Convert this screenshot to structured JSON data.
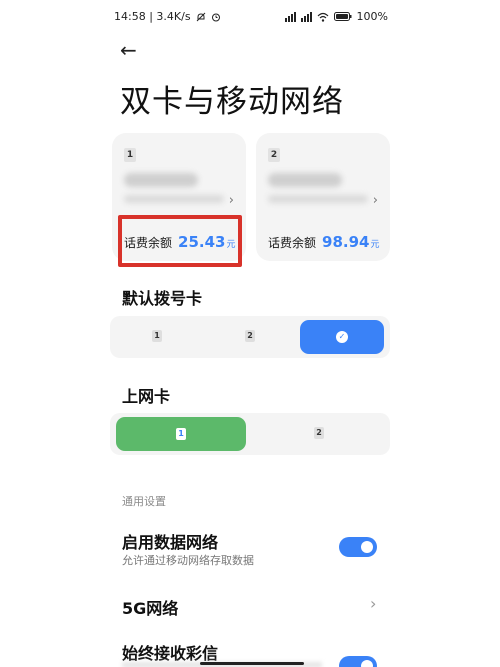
{
  "status_bar": {
    "time_speed": "14:58 | 3.4K/s",
    "battery": "100%"
  },
  "header": {
    "title": "双卡与移动网络"
  },
  "sim_cards": [
    {
      "slot": "1",
      "balance_label": "话费余额",
      "balance_value": "25.43",
      "balance_unit": "元"
    },
    {
      "slot": "2",
      "balance_label": "话费余额",
      "balance_value": "98.94",
      "balance_unit": "元"
    }
  ],
  "default_dial": {
    "title": "默认拨号卡",
    "options": [
      "1",
      "2",
      "✓"
    ],
    "selected": "always-ask"
  },
  "data_card": {
    "title": "上网卡",
    "options": [
      "1",
      "2"
    ],
    "selected": "1"
  },
  "general": {
    "group_label": "通用设置",
    "mobile_data": {
      "title": "启用数据网络",
      "subtitle": "允许通过移动网络存取数据",
      "enabled": true
    },
    "five_g": {
      "title": "5G网络"
    },
    "mms": {
      "title": "始终接收彩信",
      "enabled": true
    }
  },
  "colors": {
    "accent_blue": "#3a82f7",
    "accent_green": "#5cb96a",
    "highlight_red": "#d8322a"
  }
}
